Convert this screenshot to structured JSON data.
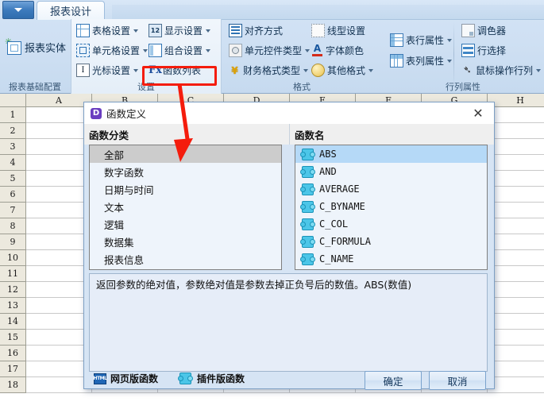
{
  "window": {
    "app_button_icon": "caret-down-icon",
    "tab": {
      "label": "报表设计"
    }
  },
  "ribbon": {
    "groups": [
      {
        "name": "报表基础配置",
        "big_item": {
          "label": "报表实体",
          "icon": "report-entity-icon"
        },
        "items": []
      },
      {
        "name": "设置",
        "items": [
          {
            "label": "表格设置",
            "icon": "table-grid-icon",
            "dropdown": true
          },
          {
            "label": "单元格设置",
            "icon": "cell-icon",
            "dropdown": true
          },
          {
            "label": "光标设置",
            "icon": "text-cursor-icon",
            "dropdown": true
          },
          {
            "label": "显示设置",
            "icon": "number-12-icon",
            "dropdown": true
          },
          {
            "label": "组合设置",
            "icon": "combo-icon",
            "dropdown": true
          },
          {
            "label": "函数列表",
            "icon": "fx-icon",
            "dropdown": false,
            "highlighted": true
          }
        ]
      },
      {
        "name": "格式",
        "items": [
          {
            "label": "对齐方式",
            "icon": "align-icon",
            "dropdown": false
          },
          {
            "label": "单元控件类型",
            "icon": "control-type-icon",
            "dropdown": true
          },
          {
            "label": "财务格式类型",
            "icon": "yen-currency-icon",
            "dropdown": true
          },
          {
            "label": "线型设置",
            "icon": "line-style-icon",
            "dropdown": false
          },
          {
            "label": "字体颜色",
            "icon": "font-color-icon",
            "dropdown": false
          },
          {
            "label": "其他格式",
            "icon": "lightbulb-icon",
            "dropdown": true
          }
        ]
      },
      {
        "name": "行列属性",
        "items": [
          {
            "label": "表行属性",
            "icon": "table-row-icon",
            "dropdown": true
          },
          {
            "label": "表列属性",
            "icon": "table-column-icon",
            "dropdown": true
          },
          {
            "label": "调色器",
            "icon": "palette-icon",
            "dropdown": false
          },
          {
            "label": "行选择",
            "icon": "row-select-icon",
            "dropdown": false
          },
          {
            "label": "鼠标操作行列",
            "icon": "mouse-pointer-icon",
            "dropdown": true
          }
        ]
      }
    ]
  },
  "sheet": {
    "columns": [
      "A",
      "B",
      "C",
      "D",
      "E",
      "F",
      "G",
      "H"
    ],
    "rows": [
      "1",
      "2",
      "3",
      "4",
      "5",
      "6",
      "7",
      "8",
      "9",
      "10",
      "11",
      "12",
      "13",
      "14",
      "15",
      "16",
      "17",
      "18"
    ]
  },
  "dialog": {
    "title": "函数定义",
    "logo_letter": "D",
    "close_icon": "close-icon",
    "left_header": "函数分类",
    "right_header": "函数名",
    "categories": [
      {
        "label": "全部",
        "selected": true
      },
      {
        "label": "数字函数",
        "selected": false
      },
      {
        "label": "日期与时间",
        "selected": false
      },
      {
        "label": "文本",
        "selected": false
      },
      {
        "label": "逻辑",
        "selected": false
      },
      {
        "label": "数据集",
        "selected": false
      },
      {
        "label": "报表信息",
        "selected": false
      }
    ],
    "functions": [
      {
        "label": "ABS",
        "selected": true
      },
      {
        "label": "AND",
        "selected": false
      },
      {
        "label": "AVERAGE",
        "selected": false
      },
      {
        "label": "C_BYNAME",
        "selected": false
      },
      {
        "label": "C_COL",
        "selected": false
      },
      {
        "label": "C_FORMULA",
        "selected": false
      },
      {
        "label": "C_NAME",
        "selected": false
      }
    ],
    "description": "返回参数的绝对值，参数绝对值是参数去掉正负号后的数值。ABS(数值)",
    "footer": {
      "web_functions": {
        "label": "网页版函数",
        "icon": "html-icon"
      },
      "plugin_functions": {
        "label": "插件版函数",
        "icon": "puzzle-icon"
      },
      "ok": "确定",
      "cancel": "取消"
    }
  },
  "annotation": {
    "arrow_color": "#f41c0c",
    "highlight_color": "#f41c0c"
  }
}
